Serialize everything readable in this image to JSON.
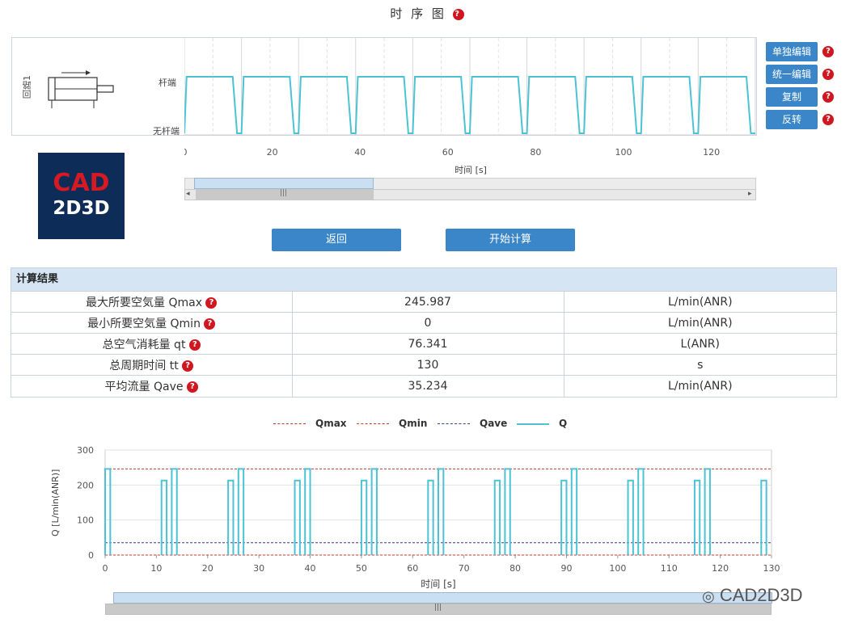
{
  "timing": {
    "title": "时 序 图",
    "circuit_label": "回路1",
    "state_high": "杆端",
    "state_low": "无杆端",
    "x_ticks": [
      "0",
      "20",
      "40",
      "60",
      "80",
      "100",
      "120"
    ],
    "xlabel": "时间 [s]",
    "period_s": 13,
    "view_range_s": [
      0,
      130
    ]
  },
  "side_buttons": {
    "edit_single": "单独编辑",
    "edit_unified": "统一编辑",
    "copy": "复制",
    "invert": "反转"
  },
  "logo": {
    "line1": "CAD",
    "line2": "2D3D"
  },
  "actions": {
    "back": "返回",
    "start": "开始计算"
  },
  "results": {
    "header": "计算结果",
    "rows": [
      {
        "label": "最大所要空気量 Qmax",
        "value": "245.987",
        "unit": "L/min(ANR)"
      },
      {
        "label": "最小所要空気量 Qmin",
        "value": "0",
        "unit": "L/min(ANR)"
      },
      {
        "label": "总空气消耗量 qt",
        "value": "76.341",
        "unit": "L(ANR)"
      },
      {
        "label": "总周期时间 tt",
        "value": "130",
        "unit": "s"
      },
      {
        "label": "平均流量 Qave",
        "value": "35.234",
        "unit": "L/min(ANR)"
      }
    ]
  },
  "chart_data": {
    "type": "line",
    "xlabel": "时间 [s]",
    "ylabel": "Q [L/min(ANR)]",
    "xlim": [
      0,
      130
    ],
    "ylim": [
      0,
      300
    ],
    "x_ticks": [
      0,
      10,
      20,
      30,
      40,
      50,
      60,
      70,
      80,
      90,
      100,
      110,
      120,
      130
    ],
    "y_ticks": [
      0,
      100,
      200,
      300
    ],
    "grid": true,
    "legend": "top-center",
    "series": [
      {
        "name": "Qmax",
        "style": "dashed",
        "color": "#c0392b",
        "values": [
          245.987
        ]
      },
      {
        "name": "Qmin",
        "style": "dashed",
        "color": "#c0392b",
        "values": [
          0
        ]
      },
      {
        "name": "Qave",
        "style": "dashed",
        "color": "#2c3e8f",
        "values": [
          35.234
        ]
      },
      {
        "name": "Q",
        "style": "solid",
        "color": "#4cc3d4",
        "pulses": [
          {
            "start": 0,
            "end": 1,
            "value": 245.987
          },
          {
            "start": 11,
            "end": 12,
            "value": 213
          },
          {
            "start": 13,
            "end": 14,
            "value": 245.987
          },
          {
            "start": 24,
            "end": 25,
            "value": 213
          },
          {
            "start": 26,
            "end": 27,
            "value": 245.987
          },
          {
            "start": 37,
            "end": 38,
            "value": 213
          },
          {
            "start": 39,
            "end": 40,
            "value": 245.987
          },
          {
            "start": 50,
            "end": 51,
            "value": 213
          },
          {
            "start": 52,
            "end": 53,
            "value": 245.987
          },
          {
            "start": 63,
            "end": 64,
            "value": 213
          },
          {
            "start": 65,
            "end": 66,
            "value": 245.987
          },
          {
            "start": 76,
            "end": 77,
            "value": 213
          },
          {
            "start": 78,
            "end": 79,
            "value": 245.987
          },
          {
            "start": 89,
            "end": 90,
            "value": 213
          },
          {
            "start": 91,
            "end": 92,
            "value": 245.987
          },
          {
            "start": 102,
            "end": 103,
            "value": 213
          },
          {
            "start": 104,
            "end": 105,
            "value": 245.987
          },
          {
            "start": 115,
            "end": 116,
            "value": 213
          },
          {
            "start": 117,
            "end": 118,
            "value": 245.987
          },
          {
            "start": 128,
            "end": 129,
            "value": 213
          }
        ]
      }
    ]
  },
  "watermark": "CAD2D3D"
}
